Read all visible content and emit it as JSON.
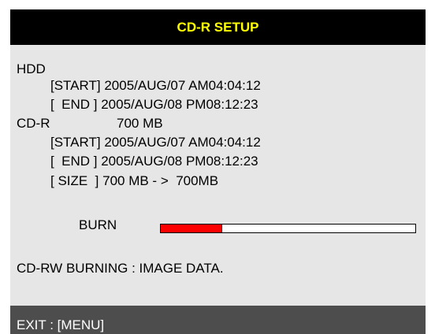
{
  "window": {
    "title": "CD-R SETUP"
  },
  "hdd": {
    "label": "HDD",
    "start": "[START] 2005/AUG/07 AM04:04:12",
    "end": "[  END ] 2005/AUG/08 PM08:12:23"
  },
  "cdr": {
    "label": "CD-R",
    "capacity": "700 MB",
    "start": "[START] 2005/AUG/07 AM04:04:12",
    "end": "[  END ] 2005/AUG/08 PM08:12:23",
    "size": "[ SIZE  ] 700 MB - >  700MB"
  },
  "burn": {
    "label": "BURN",
    "progress_percent": 24
  },
  "status": {
    "message": "CD-RW BURNING : IMAGE DATA."
  },
  "footer": {
    "exit_hint": "EXIT : [MENU]"
  },
  "colors": {
    "title_bar": "#000000",
    "title_text": "#ffff00",
    "panel_background": "#e6e6e6",
    "footer_bar": "#4d4d4d",
    "progress_fill": "#ff0000",
    "progress_track": "#ffffff"
  }
}
